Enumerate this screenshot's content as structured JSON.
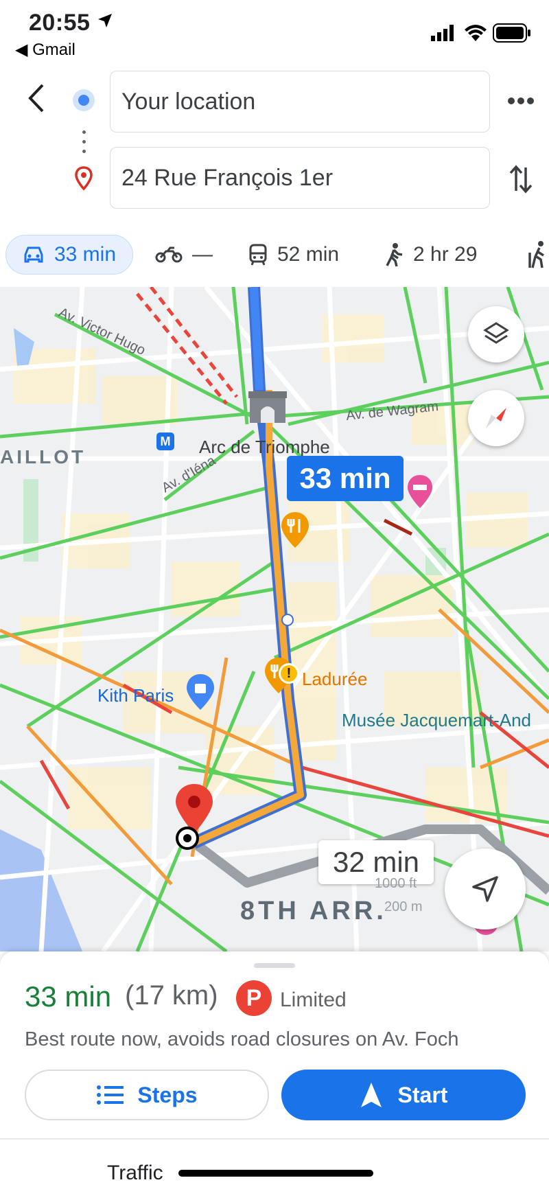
{
  "status_bar": {
    "time": "20:55",
    "back_app": "Gmail"
  },
  "header": {
    "origin": "Your location",
    "destination": "24 Rue François 1er"
  },
  "modes": [
    {
      "name": "drive",
      "label": "33 min",
      "active": true
    },
    {
      "name": "motorbike",
      "label": "—",
      "active": false
    },
    {
      "name": "transit",
      "label": "52 min",
      "active": false
    },
    {
      "name": "walk",
      "label": "2 hr 29",
      "active": false
    }
  ],
  "map": {
    "route_time": "33 min",
    "alt_route_time": "32 min",
    "labels": {
      "arc": "Arc de Triomphe",
      "maillot": "AILLOT",
      "victor_hugo": "Av. Victor Hugo",
      "wagram": "Av. de Wagram",
      "iena": "Av. d'Iéna",
      "laduree": "Ladurée",
      "kith": "Kith Paris",
      "musee": "Musée Jacquemart-And",
      "arr": "8TH ARR."
    },
    "scale": {
      "imperial": "1000 ft",
      "metric": "200 m"
    }
  },
  "summary": {
    "eta": "33 min",
    "distance": "(17 km)",
    "parking_icon": "P",
    "parking": "Limited",
    "description": "Best route now, avoids road closures on Av. Foch",
    "steps_label": "Steps",
    "start_label": "Start",
    "traffic_label": "Traffic"
  },
  "colors": {
    "accent": "#1a73e8",
    "eta": "#188038",
    "route": "#f4a83a",
    "traffic_green": "#5ccf5c"
  }
}
